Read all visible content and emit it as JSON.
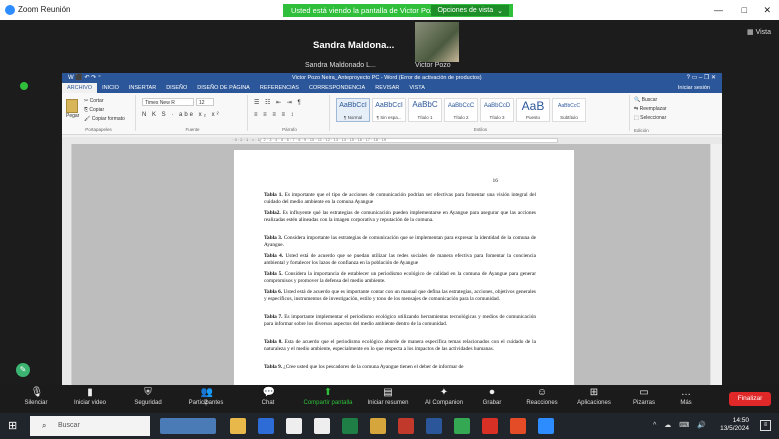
{
  "zoom": {
    "title": "Zoom Reunión",
    "banner": "Usted está viendo la pantalla de Victor Pozo",
    "view_options": "Opciones de vista",
    "view_options_caret": "⌄",
    "vista": "Vista",
    "speaker_big": "Sandra Maldona...",
    "speaker_small": "Sandra Maldonado L...",
    "video_name": "Victor Pozo",
    "window_controls": {
      "minimize": "—",
      "maximize": "□",
      "close": "✕"
    }
  },
  "word": {
    "qat": "W ⬛ ↶ ↷ ⁼",
    "doc_title": "Victor Pozo Neira_Anteproyecto PC - Word (Error de activación de productos)",
    "window_controls": "?  ▭  –  ❐  ✕",
    "tabs": [
      "ARCHIVO",
      "INICIO",
      "INSERTAR",
      "DISEÑO",
      "DISEÑO DE PÁGINA",
      "REFERENCIAS",
      "CORRESPONDENCIA",
      "REVISAR",
      "VISTA"
    ],
    "signin": "Iniciar sesión",
    "ribbon": {
      "paste": "Pegar",
      "cut": "Cortar",
      "copy": "Copiar",
      "format_painter": "Copiar formato",
      "clipboard_group": "Portapapeles",
      "font_name": "Times New R",
      "font_size": "12",
      "font_group": "Fuente",
      "paragraph_group": "Párrafo",
      "styles_group": "Estilos",
      "editing_group": "Edición",
      "bold_italic_row": "N K S · abe x₂ x²",
      "styles": [
        {
          "sample": "AaBbCcI",
          "name": "¶ Normal"
        },
        {
          "sample": "AaBbCcI",
          "name": "¶ Sin espa..."
        },
        {
          "sample": "AaBbC",
          "name": "Título 1"
        },
        {
          "sample": "AaBbCcC",
          "name": "Título 2"
        },
        {
          "sample": "AaBbCcD",
          "name": "Título 3"
        },
        {
          "sample": "AaB",
          "name": "Puesto"
        },
        {
          "sample": "AaBbCcC",
          "name": "Subtítulo"
        }
      ],
      "find": "Buscar",
      "replace": "Reemplazar",
      "select": "Seleccionar"
    },
    "ruler": "· 3 · 2 · 1 · ⌂ · 1 · 2 · 3 · 4 · 5 · 6 · 7 · 8 · 9 · 10 · 11 · 12 · 13 · 14 · 15 · 16 · 17 · 18 · 19",
    "page_number": "16",
    "paragraphs": [
      {
        "head": "Tabla 1.",
        "text": " Es importante que el tipo de acciones de comunicación podrían ser efectivas para fomentar una visión integral del cuidado del medio ambiente en la comuna Ayangue"
      },
      {
        "head": "Tabla2.",
        "text": " Es influyente qué las estrategias de comunicación pueden implementarse en Ayangue para asegurar que las acciones realizadas estén alineadas con la imagen corporativa y reputación de la comuna."
      },
      {
        "head": "Tabla 3.",
        "text": " Considera importante las estrategias de comunicación que se implementan para expresar la identidad de la comuna de Ayangue."
      },
      {
        "head": "Tabla 4.",
        "text": " Usted está de acuerdo que se puedan utilizar las redes sociales de manera efectiva para fomentar la conciencia ambiental y fortalecer los lazos de confianza en la población de Ayangue"
      },
      {
        "head": "Tabla 5.",
        "text": " Considera la importancia de establecer un periodismo ecológico de calidad en la comuna de Ayangue para generar compromisos y promover la defensa del medio ambiente."
      },
      {
        "head": "Tabla 6.",
        "text": " Usted está de acuerdo que es importante contar con un manual que defina las estrategias, acciones, objetivos generales y específicos, instrumentos de investigación, estilo y tono de los mensajes de comunicación para la comunidad."
      },
      {
        "head": "Tabla 7.",
        "text": " Es importante implementar el periodismo ecológico utilizando herramientas tecnológicas y medios de comunicación para informar sobre los diversos aspectos del medio ambiente dentro de la comunidad."
      },
      {
        "head": "Tabla 8.",
        "text": " Esta de acuerdo que el periodismo ecológico aborde de manera específica temas relacionados con el cuidado de la naturaleza y el medio ambiente, especialmente en lo que respecta a los impactos de las actividades humanas."
      },
      {
        "head": "Tabla 9.",
        "text": " ¿Cree usted que los pescadores de la comuna Ayangue tienen el deber de informar de"
      }
    ]
  },
  "controls": [
    {
      "label": "Silenciar",
      "icon": "🎙"
    },
    {
      "label": "Iniciar video",
      "icon": "▮"
    },
    {
      "label": "Seguridad",
      "icon": "⛨"
    },
    {
      "label": "Participantes",
      "icon": "👥",
      "count": "2"
    },
    {
      "label": "Chat",
      "icon": "💬"
    },
    {
      "label": "Compartir pantalla",
      "icon": "⬆",
      "active": true
    },
    {
      "label": "Iniciar resumen",
      "icon": "▤"
    },
    {
      "label": "AI Companion",
      "icon": "✦"
    },
    {
      "label": "Grabar",
      "icon": "⏺"
    },
    {
      "label": "Reacciones",
      "icon": "☺"
    },
    {
      "label": "Aplicaciones",
      "icon": "⊞"
    },
    {
      "label": "Pizarras",
      "icon": "▭"
    },
    {
      "label": "Más",
      "icon": "…"
    }
  ],
  "end_button": "Finalizar",
  "taskbar": {
    "search_placeholder": "Buscar",
    "tray_icons": "^ ☁ ⌨ 🔊",
    "time": "14:50",
    "date": "13/5/2024"
  },
  "colors": {
    "zoom_green": "#2fbf3a",
    "word_blue": "#2b579a",
    "end_red": "#e02828"
  }
}
